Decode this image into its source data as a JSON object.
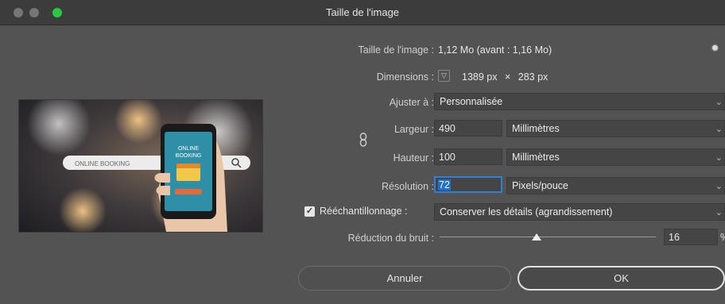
{
  "window": {
    "title": "Taille de l'image"
  },
  "colors": {
    "close": "#ff5f57",
    "minimize": "#e0e0e0",
    "zoom": "#28c840",
    "accent": "#1f6fd0"
  },
  "image_size": {
    "label": "Taille de l'image :",
    "value": "1,12 Mo (avant : 1,16 Mo)"
  },
  "dimensions": {
    "label": "Dimensions :",
    "width": "1389 px",
    "times": "×",
    "height": "283 px"
  },
  "fit_to": {
    "label": "Ajuster à :",
    "value": "Personnalisée"
  },
  "width": {
    "label": "Largeur :",
    "value": "490",
    "unit": "Millimètres"
  },
  "height": {
    "label": "Hauteur :",
    "value": "100",
    "unit": "Millimètres"
  },
  "resolution": {
    "label": "Résolution :",
    "value": "72",
    "unit": "Pixels/pouce"
  },
  "resample": {
    "label": "Rééchantillonnage :",
    "checked": true,
    "method": "Conserver les détails (agrandissement)"
  },
  "noise": {
    "label": "Réduction du bruit :",
    "value": "16",
    "percent": "%",
    "level": 0.16
  },
  "buttons": {
    "cancel": "Annuler",
    "ok": "OK"
  },
  "preview": {
    "search_text": "ONLINE BOOKING",
    "phone_title_1": "ONLINE",
    "phone_title_2": "BOOKING"
  }
}
